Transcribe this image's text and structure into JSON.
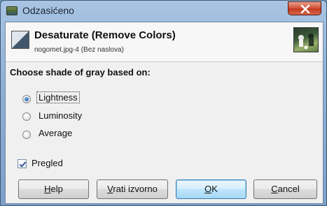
{
  "window": {
    "title": "Odzasićeno"
  },
  "header": {
    "title": "Desaturate (Remove Colors)",
    "subtitle": "nogomet.jpg-4 (Bez naslova)"
  },
  "section_label": "Choose shade of gray based on:",
  "options": [
    {
      "label": "Lightness",
      "selected": true
    },
    {
      "label": "Luminosity",
      "selected": false
    },
    {
      "label": "Average",
      "selected": false
    }
  ],
  "preview": {
    "label": "Pregled",
    "checked": true
  },
  "buttons": {
    "help_mnemonic": "H",
    "help_rest": "elp",
    "reset_mnemonic": "V",
    "reset_rest": "rati izvorno",
    "ok_mnemonic": "O",
    "ok_rest": "K",
    "cancel_mnemonic": "C",
    "cancel_rest": "ancel"
  },
  "colors": {
    "accent": "#3c7fb1",
    "close": "#c23a1f"
  },
  "icons": {
    "app": "gimp-image-icon",
    "close": "close-icon",
    "filter": "desaturate-icon",
    "thumbnail": "image-thumbnail"
  }
}
